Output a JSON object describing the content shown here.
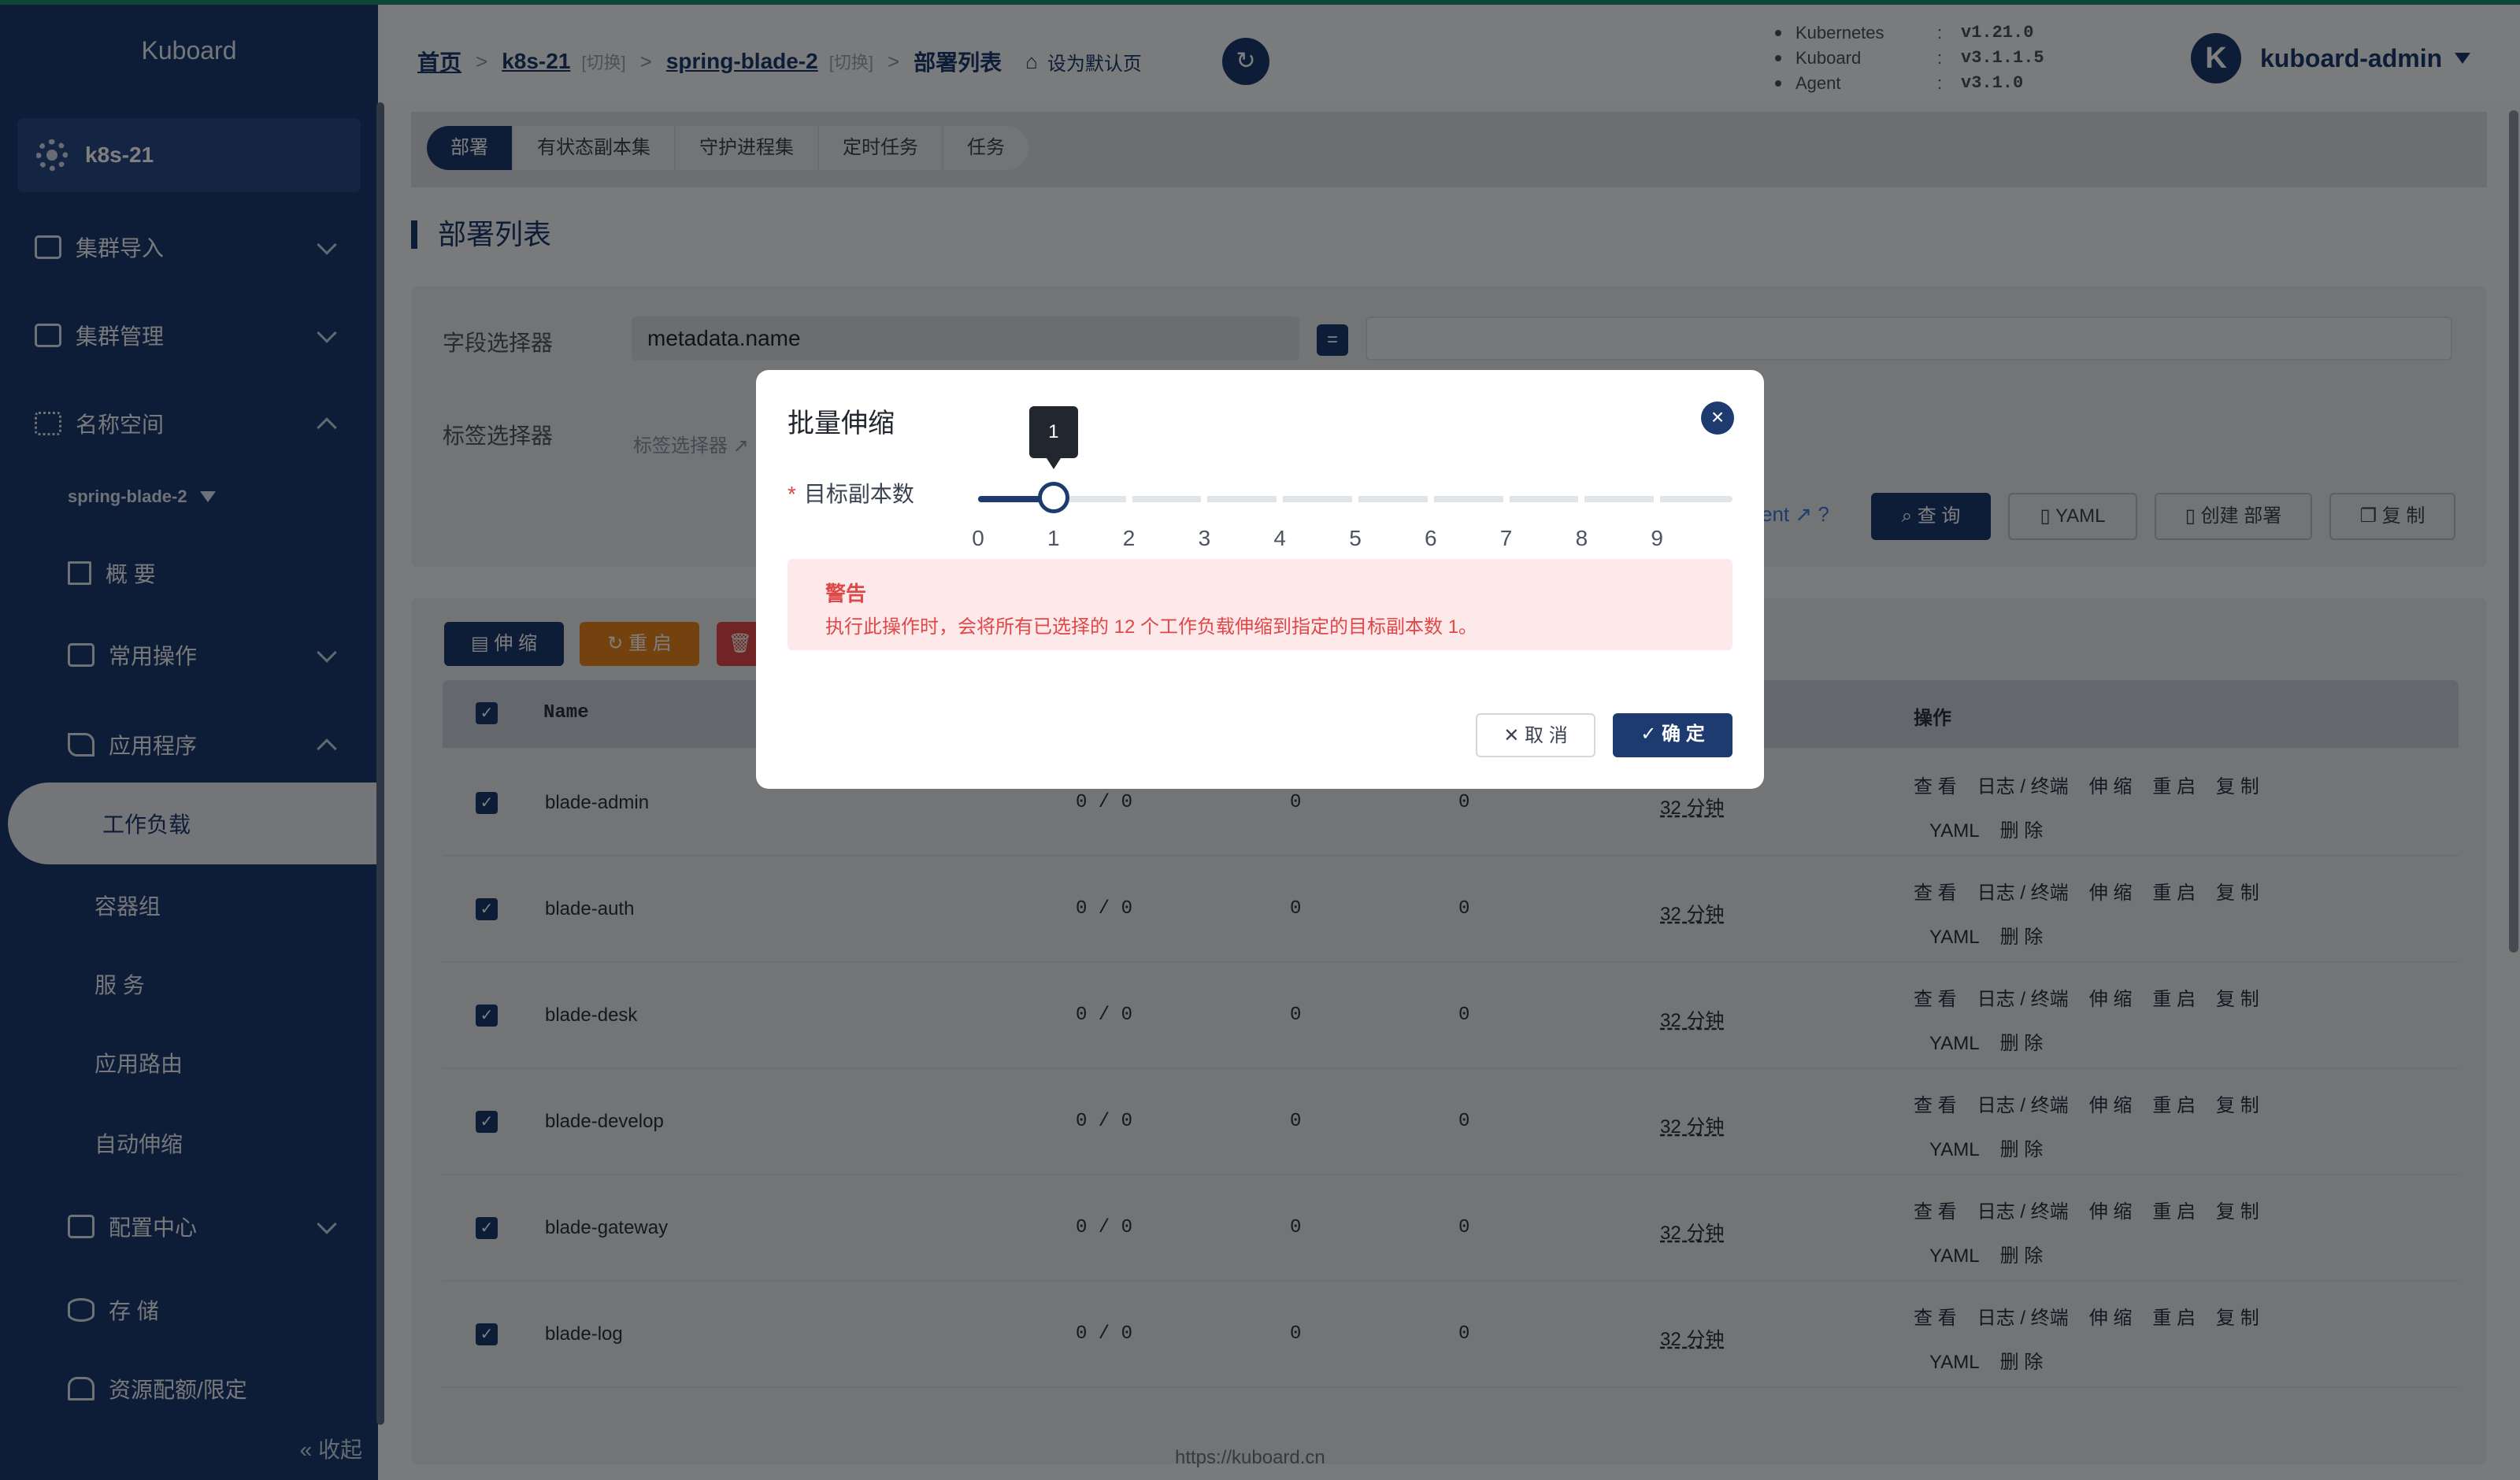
{
  "app": {
    "brand": "Kuboard",
    "cluster": "k8s-21",
    "collapse": "收起",
    "footer_url": "https://kuboard.cn"
  },
  "colors": {
    "primary": "#1d3b6e",
    "warning": "#e04848",
    "restart": "#e6851e",
    "delete": "#e04848"
  },
  "sidebar": {
    "items": [
      {
        "label": "集群导入",
        "icon": "cluster-import-icon"
      },
      {
        "label": "集群管理",
        "icon": "cluster-manage-icon"
      },
      {
        "label": "名称空间",
        "icon": "namespace-icon"
      },
      {
        "label": "概 要",
        "icon": "home-icon"
      },
      {
        "label": "常用操作",
        "icon": "folder-icon"
      },
      {
        "label": "应用程序",
        "icon": "send-icon"
      },
      {
        "label": "工作负载"
      },
      {
        "label": "容器组"
      },
      {
        "label": "服 务"
      },
      {
        "label": "应用路由"
      },
      {
        "label": "自动伸缩"
      },
      {
        "label": "配置中心",
        "icon": "config-icon"
      },
      {
        "label": "存 储",
        "icon": "storage-icon"
      },
      {
        "label": "资源配额/限定",
        "icon": "quota-icon"
      }
    ],
    "namespace": "spring-blade-2"
  },
  "header": {
    "crumb_home": "首页",
    "crumb_cluster": "k8s-21",
    "switch": "[切换]",
    "crumb_ns": "spring-blade-2",
    "crumb_current": "部署列表",
    "set_default": "设为默认页",
    "versions": [
      {
        "key": "Kubernetes",
        "val": "v1.21.0"
      },
      {
        "key": "Kuboard",
        "val": "v3.1.1.5"
      },
      {
        "key": "Agent",
        "val": "v3.1.0"
      }
    ],
    "avatar_letter": "K",
    "user": "kuboard-admin"
  },
  "tabs": [
    "部署",
    "有状态副本集",
    "守护进程集",
    "定时任务",
    "任务"
  ],
  "page_title": "部署列表",
  "filter": {
    "field_label": "字段选择器",
    "field_value": "metadata.name",
    "eq": "=",
    "label_label": "标签选择器",
    "label_placeholder": "标签选择器",
    "doc_fragment": "ent",
    "query": "查 询",
    "yaml": "YAML",
    "create": "创建 部署",
    "copy": "复 制"
  },
  "actions": {
    "scale": "伸 缩",
    "restart": "重 启"
  },
  "table": {
    "name_header": "Name",
    "ops_header": "操作",
    "op_labels": [
      "查 看",
      "日志 / 终端",
      "伸 缩",
      "重 启",
      "复 制",
      "YAML",
      "删 除"
    ],
    "rows": [
      {
        "name": "blade-admin",
        "replicas": "0 / 0",
        "c2": "0",
        "c3": "0",
        "age": "32 分钟"
      },
      {
        "name": "blade-auth",
        "replicas": "0 / 0",
        "c2": "0",
        "c3": "0",
        "age": "32 分钟"
      },
      {
        "name": "blade-desk",
        "replicas": "0 / 0",
        "c2": "0",
        "c3": "0",
        "age": "32 分钟"
      },
      {
        "name": "blade-develop",
        "replicas": "0 / 0",
        "c2": "0",
        "c3": "0",
        "age": "32 分钟"
      },
      {
        "name": "blade-gateway",
        "replicas": "0 / 0",
        "c2": "0",
        "c3": "0",
        "age": "32 分钟"
      },
      {
        "name": "blade-log",
        "replicas": "0 / 0",
        "c2": "0",
        "c3": "0",
        "age": "32 分钟"
      }
    ]
  },
  "dialog": {
    "title": "批量伸缩",
    "label": "目标副本数",
    "required_mark": "*",
    "slider_min": 0,
    "slider_max": 10,
    "slider_value": 1,
    "tooltip": "1",
    "marks": [
      "0",
      "1",
      "2",
      "3",
      "4",
      "5",
      "6",
      "7",
      "8",
      "9"
    ],
    "warn_title": "警告",
    "warn_text": "执行此操作时，会将所有已选择的 12 个工作负载伸缩到指定的目标副本数 1。",
    "cancel": "取 消",
    "ok": "确 定"
  }
}
